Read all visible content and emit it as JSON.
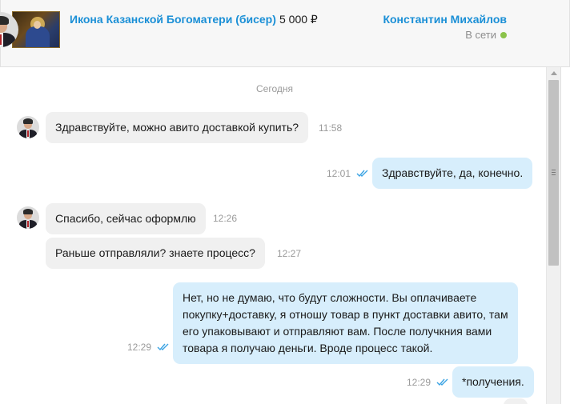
{
  "header": {
    "product_title": "Икона Казанской Богоматери (бисер)",
    "product_price": "5 000 ₽",
    "seller_name": "Константин Михайлов",
    "seller_status": "В сети"
  },
  "chat": {
    "date_separator": "Сегодня",
    "messages": [
      {
        "direction": "in",
        "text": "Здравствуйте, можно авито доставкой купить?",
        "time": "11:58"
      },
      {
        "direction": "out",
        "text": "Здравствуйте, да, конечно.",
        "time": "12:01",
        "read": true
      },
      {
        "direction": "in",
        "text": "Спасибо, сейчас оформлю",
        "time": "12:26"
      },
      {
        "direction": "in",
        "text": "Раньше отправляли? знаете процесс?",
        "time": "12:27"
      },
      {
        "direction": "out",
        "lines": [
          "Нет, но не думаю, что будут сложности. Вы оплачиваете",
          "покупку+доставку, я отношу товар в пункт доставки авито, там",
          "его упаковывают и отправляют вам. После получкния вами",
          "товара я получаю деньги. Вроде процесс такой."
        ],
        "time": "12:29",
        "read": true
      },
      {
        "direction": "out",
        "text": "*получения.",
        "time": "12:29",
        "read": true
      }
    ]
  },
  "colors": {
    "link_blue": "#1a8fd6",
    "incoming_bubble": "#f0f0f0",
    "outgoing_bubble": "#d7eefc",
    "online_green": "#8bc34a",
    "read_check": "#3aa3e3"
  },
  "icons": {
    "read_receipt": "double-check-icon",
    "online": "online-dot-icon"
  }
}
